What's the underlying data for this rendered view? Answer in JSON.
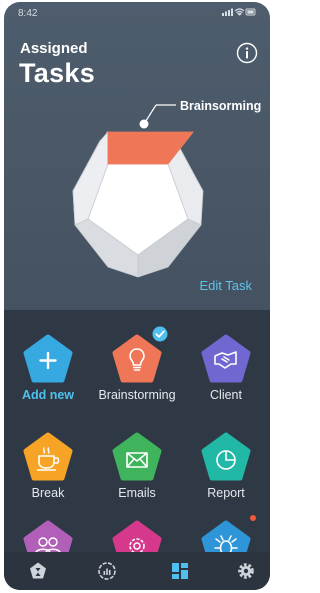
{
  "status_bar": {
    "time": "8:42"
  },
  "header": {
    "subtitle": "Assigned",
    "title": "Tasks",
    "info_icon": "info-icon"
  },
  "shape": {
    "selected_face_label": "Brainsorming",
    "selected_face_color": "#ef7758",
    "edit_label": "Edit Task"
  },
  "colors": {
    "accent": "#4fc0ee",
    "bg_top": "#4e5d6d",
    "grid_bg": "#2f3946"
  },
  "tiles": [
    {
      "label": "Add new",
      "icon": "plus-icon",
      "color": "#36a9e1"
    },
    {
      "label": "Brainstorming",
      "icon": "lightbulb-icon",
      "color": "#ef7758",
      "checked": true
    },
    {
      "label": "Client",
      "icon": "handshake-icon",
      "color": "#7167d1"
    },
    {
      "label": "Break",
      "icon": "coffee-icon",
      "color": "#f7a325"
    },
    {
      "label": "Emails",
      "icon": "envelope-icon",
      "color": "#3fb45c"
    },
    {
      "label": "Report",
      "icon": "pie-chart-icon",
      "color": "#22b8a6"
    },
    {
      "label": "",
      "icon": "team-icon",
      "color": "#b15fb8"
    },
    {
      "label": "",
      "icon": "gear-icon",
      "color": "#d6398b"
    },
    {
      "label": "",
      "icon": "bug-icon",
      "color": "#2d95d8",
      "notification_dot": "#ef5a3a"
    }
  ],
  "tabbar": {
    "items": [
      {
        "icon": "hourglass-icon"
      },
      {
        "icon": "progress-icon"
      },
      {
        "icon": "grid-icon",
        "active": true
      },
      {
        "icon": "settings-icon"
      }
    ]
  }
}
